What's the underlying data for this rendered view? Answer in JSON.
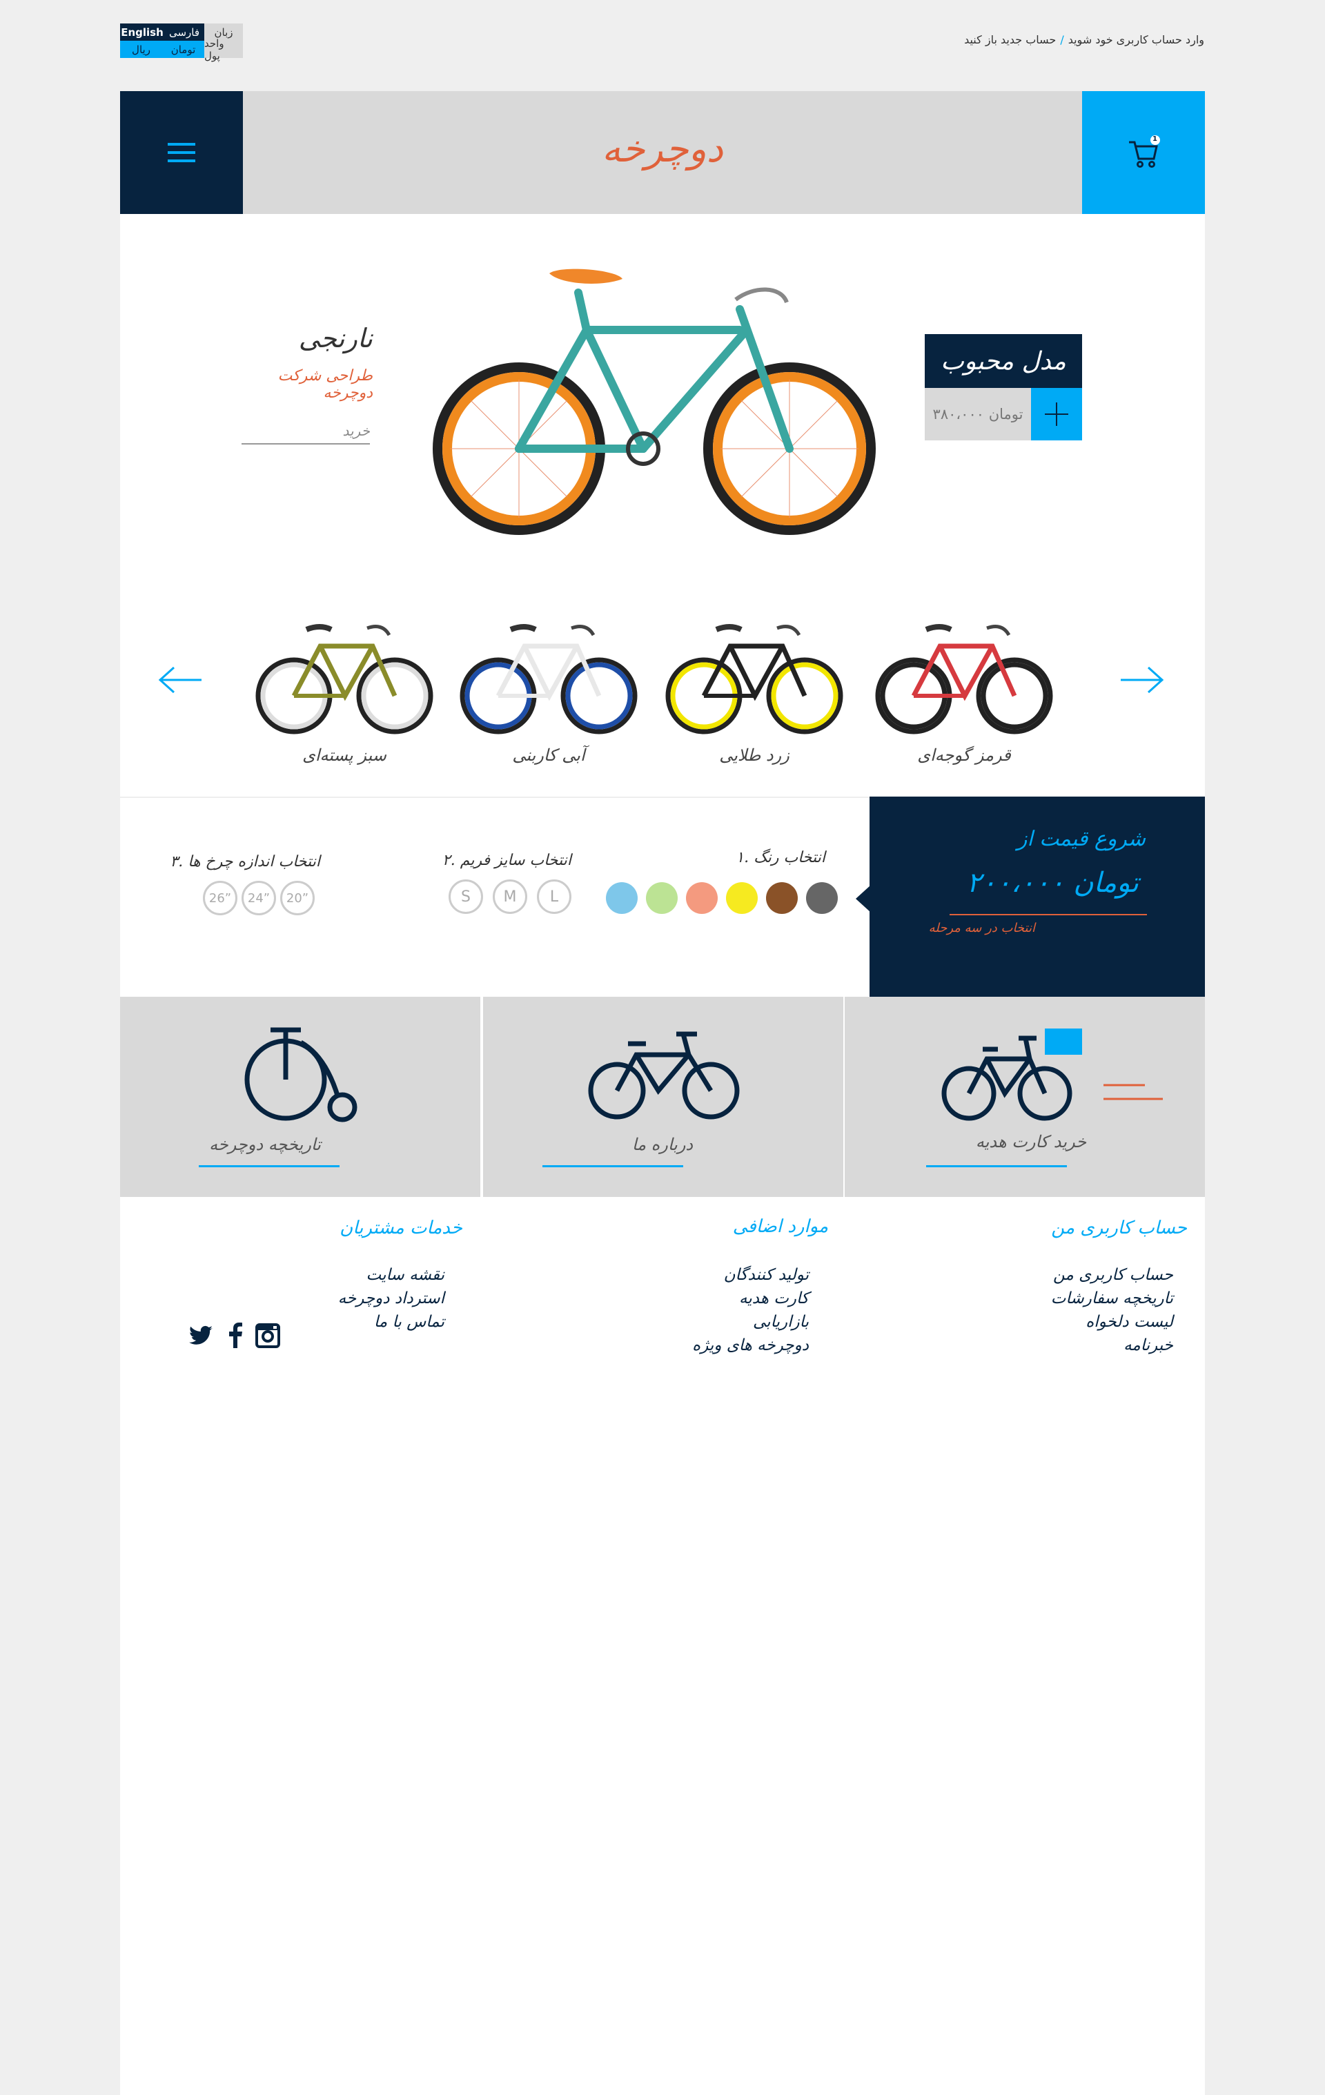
{
  "topbar": {
    "login_link": "وارد حساب کاربری خود شوید",
    "separator": "/",
    "register_link": "حساب جدید باز کنید",
    "language_label": "زبان",
    "language_en": "English",
    "language_fa": "فارسی",
    "currency_label": "واحد پول",
    "currency_toman": "تومان",
    "currency_rial": "ریال"
  },
  "header": {
    "logo_text": "دوچرخه",
    "cart_count": "1"
  },
  "hero": {
    "title": "مدل محبوب",
    "price": "۳۸۰،۰۰۰ تومان",
    "product_name": "نارنجی",
    "product_sub": "طراحی شرکت دوچرخه",
    "buy_label": "خرید"
  },
  "carousel": {
    "items": [
      {
        "label": "قرمز گوجه‌ای",
        "frame": "#d63a3f",
        "wheel": "#222222"
      },
      {
        "label": "زرد طلایی",
        "frame": "#222222",
        "wheel": "#f2e600"
      },
      {
        "label": "آبی کاربنی",
        "frame": "#e8e8e8",
        "wheel": "#1e4ea8"
      },
      {
        "label": "سبز پسته‌ای",
        "frame": "#8a8c2a",
        "wheel": "#dddddd"
      }
    ]
  },
  "config": {
    "price_from": "شروع قیمت از",
    "price_value": "۲۰۰،۰۰۰ تومان",
    "price_note": "انتخاب در سه مرحله",
    "step1": "۱. انتخاب رنگ",
    "step2": "۲. انتخاب سایز فریم",
    "step3": "۳. انتخاب اندازه چرخ ها",
    "colors": [
      "#666666",
      "#8a5228",
      "#f6ea20",
      "#f49a7f",
      "#bce394",
      "#7ec7ea"
    ],
    "sizes": [
      "L",
      "M",
      "S"
    ],
    "wheels": [
      "20”",
      "24”",
      "26”"
    ]
  },
  "cards": {
    "gift": "خرید کارت هدیه",
    "about": "درباره ما",
    "history": "تاریخچه دوچرخه"
  },
  "footer": {
    "account_title": "حساب کاربری من",
    "account_links": [
      "حساب کاربری من",
      "تاریخچه سفارشات",
      "لیست دلخواه",
      "خبرنامه"
    ],
    "extras_title": "موارد اضافی",
    "extras_links": [
      "تولید کنندگان",
      "کارت هدیه",
      "بازاریابی",
      "دوچرخه های ویژه"
    ],
    "service_title": "خدمات مشتریان",
    "service_links": [
      "نقشه سایت",
      "استرداد دوچرخه",
      "تماس با ما"
    ]
  },
  "colors": {
    "navy": "#07233f",
    "blue": "#00aaf5",
    "orange": "#e0613a",
    "gray": "#d9d9d9"
  }
}
